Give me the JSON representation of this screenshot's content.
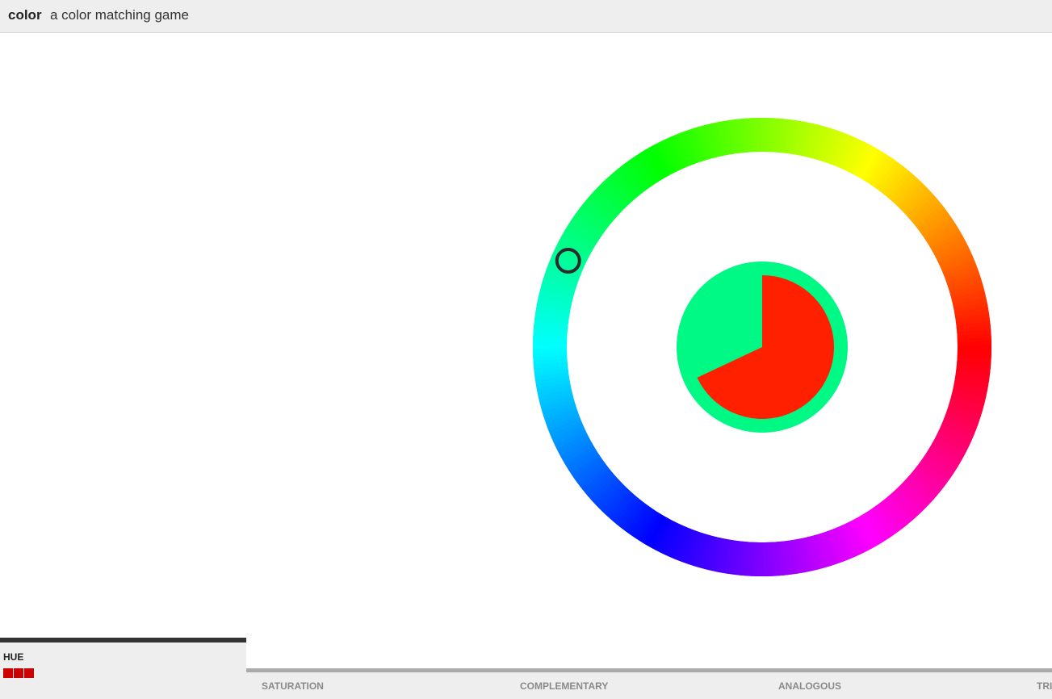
{
  "header": {
    "app_name": "color",
    "tagline": "a color matching game"
  },
  "game": {
    "mode": "HUE",
    "target_color": "#00f884",
    "guess_color": "#ff2000",
    "marker_hue_degrees": 156,
    "timer_remaining_fraction": 0.68,
    "rounds_completed": 3
  },
  "tabs": [
    {
      "label": "HUE",
      "active": true
    },
    {
      "label": "SATURATION",
      "active": false
    },
    {
      "label": "COMPLEMENTARY",
      "active": false
    },
    {
      "label": "ANALOGOUS",
      "active": false
    },
    {
      "label": "TRI",
      "active": false
    }
  ],
  "colors": {
    "progress": "#cc0000",
    "active_bar": "#333333",
    "tab_strip_bar": "#aaaaaa"
  }
}
